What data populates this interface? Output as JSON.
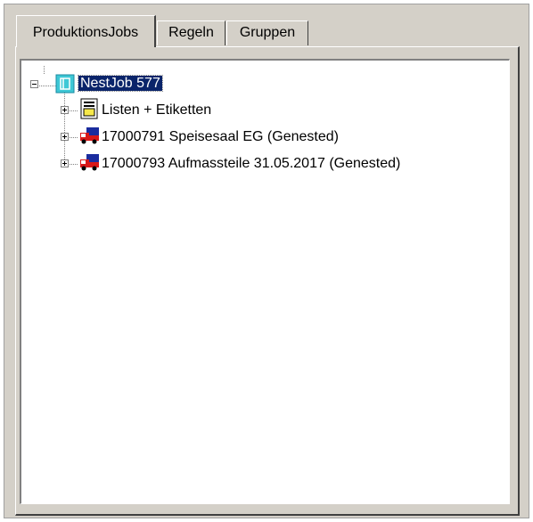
{
  "tabs": [
    {
      "label": "ProduktionsJobs",
      "active": true
    },
    {
      "label": "Regeln",
      "active": false
    },
    {
      "label": "Gruppen",
      "active": false
    }
  ],
  "tree": {
    "root": {
      "label": "NestJob 577",
      "icon": "nestjob-icon",
      "selected": true,
      "expanded": true
    },
    "children": [
      {
        "label": "Listen + Etiketten",
        "icon": "document-list-icon"
      },
      {
        "label": "17000791 Speisesaal EG (Genested)",
        "icon": "red-truck-icon"
      },
      {
        "label": "17000793 Aufmassteile 31.05.2017 (Genested)",
        "icon": "red-truck-icon"
      }
    ]
  },
  "colors": {
    "window_bg": "#d4d0c8",
    "selection_bg": "#0a246a",
    "selection_text": "#ffffff"
  }
}
